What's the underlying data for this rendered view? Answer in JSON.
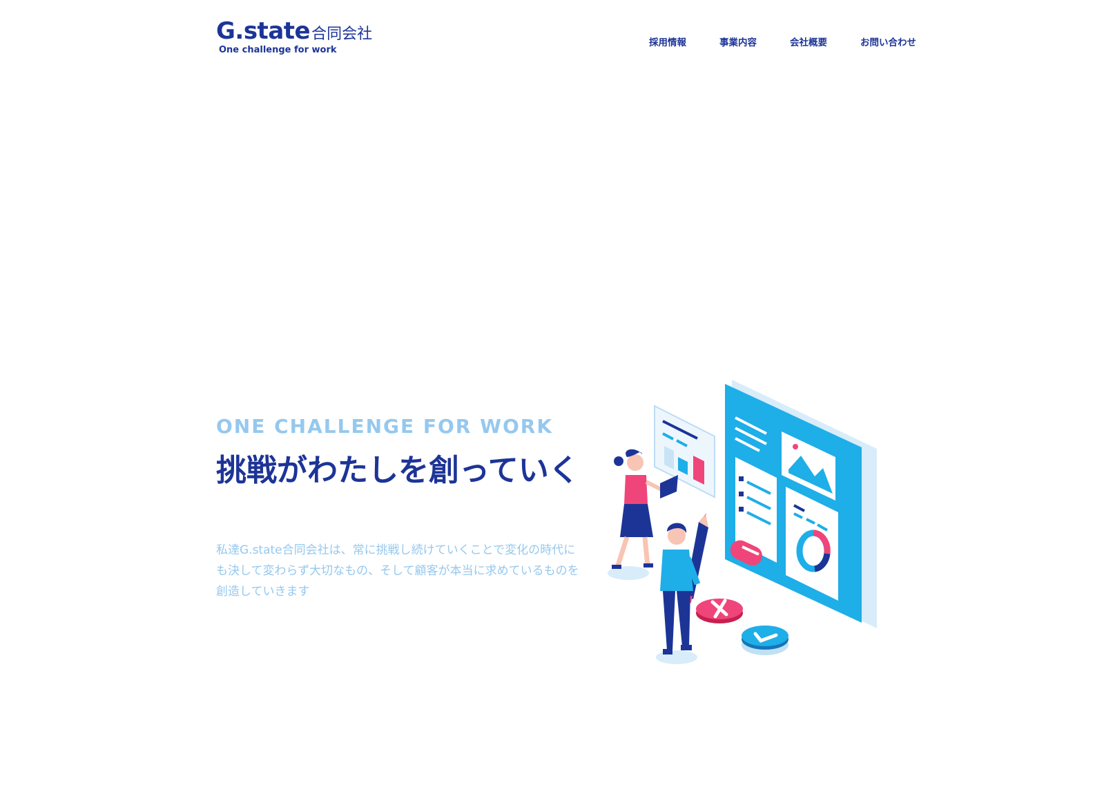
{
  "header": {
    "logo": {
      "brand": "G.state",
      "company": "合同会社",
      "tagline": "One challenge for work"
    },
    "nav": [
      {
        "label": "採用情報"
      },
      {
        "label": "事業内容"
      },
      {
        "label": "会社概要"
      },
      {
        "label": "お問い合わせ"
      }
    ]
  },
  "hero": {
    "subtitle": "ONE CHALLENGE FOR WORK",
    "title": "挑戦がわたしを創っていく",
    "description": "私達G.state合同会社は、常に挑戦し続けていくことで変化の時代にも決して変わらず大切なもの、そして顧客が本当に求めているものを創造していきます"
  },
  "colors": {
    "brand_navy": "#1d3497",
    "light_blue_text": "#95c8ee",
    "accent_cyan": "#1eaee8",
    "accent_pink": "#f0457a"
  }
}
